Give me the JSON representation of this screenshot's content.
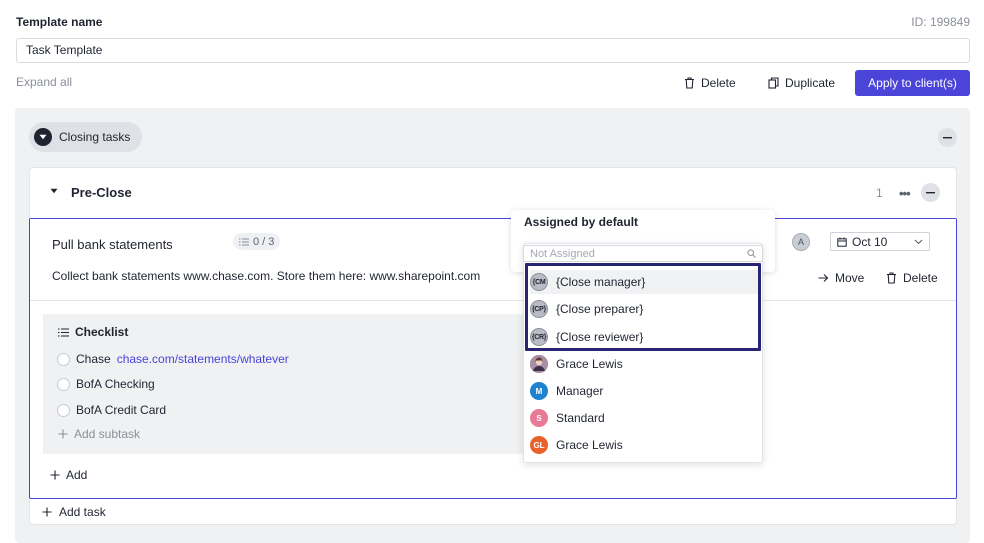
{
  "template": {
    "name_label": "Template name",
    "id_text": "ID: 199849",
    "name_value": "Task Template",
    "expand_all": "Expand all"
  },
  "toolbar": {
    "delete_label": "Delete",
    "duplicate_label": "Duplicate",
    "apply_label": "Apply to client(s)",
    "accent_color": "#4a44d9"
  },
  "section": {
    "title": "Closing tasks"
  },
  "group": {
    "title": "Pre-Close",
    "count": "1"
  },
  "task": {
    "title": "Pull bank statements",
    "subtasks": "0 / 3",
    "description": "Collect bank statements www.chase.com. Store them here: www.sharepoint.com",
    "date": "Oct 10",
    "move_label": "Move",
    "delete_label": "Delete",
    "assignee_initial": "A"
  },
  "checklist": {
    "title": "Checklist",
    "items": [
      {
        "label": "Chase",
        "link": "chase.com/statements/whatever"
      },
      {
        "label": "BofA Checking"
      },
      {
        "label": "BofA Credit Card"
      }
    ],
    "add_subtask": "Add subtask",
    "add": "Add"
  },
  "add_task": "Add task",
  "assign_popover": {
    "title": "Assigned by default",
    "search_placeholder": "Not Assigned",
    "options": [
      {
        "label": "{Close manager}",
        "badge": "{CM",
        "type": "role"
      },
      {
        "label": "{Close preparer}",
        "badge": "{CP}",
        "type": "role"
      },
      {
        "label": "{Close reviewer}",
        "badge": "{CR}",
        "type": "role"
      },
      {
        "label": "Grace Lewis",
        "badge": "",
        "type": "photo",
        "color": "#8a6f8f"
      },
      {
        "label": "Manager",
        "badge": "M",
        "type": "initial",
        "color": "#1f82d1"
      },
      {
        "label": "Standard",
        "badge": "S",
        "type": "initial",
        "color": "#e97a95"
      },
      {
        "label": "Grace Lewis",
        "badge": "GL",
        "type": "initial",
        "color": "#e9622a"
      }
    ],
    "highlight_color": "#2a2475"
  }
}
